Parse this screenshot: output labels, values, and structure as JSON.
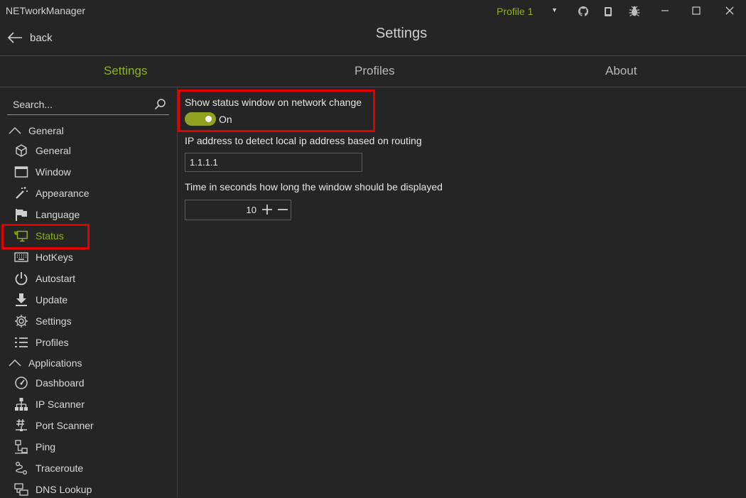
{
  "app": {
    "title": "NETworkManager",
    "profile": "Profile 1"
  },
  "header": {
    "back_label": "back",
    "title": "Settings"
  },
  "tabs": [
    {
      "label": "Settings",
      "active": true
    },
    {
      "label": "Profiles",
      "active": false
    },
    {
      "label": "About",
      "active": false
    }
  ],
  "sidebar": {
    "search_placeholder": "Search...",
    "group_general": "General",
    "group_applications": "Applications",
    "general_items": [
      {
        "label": "General",
        "icon": "cube-icon"
      },
      {
        "label": "Window",
        "icon": "window-icon"
      },
      {
        "label": "Appearance",
        "icon": "magic-wand-icon"
      },
      {
        "label": "Language",
        "icon": "flag-icon"
      },
      {
        "label": "Status",
        "icon": "monitor-network-icon",
        "active": true
      },
      {
        "label": "HotKeys",
        "icon": "keyboard-icon"
      },
      {
        "label": "Autostart",
        "icon": "power-icon"
      },
      {
        "label": "Update",
        "icon": "download-icon"
      },
      {
        "label": "Settings",
        "icon": "gear-icon"
      },
      {
        "label": "Profiles",
        "icon": "list-icon"
      }
    ],
    "application_items": [
      {
        "label": "Dashboard",
        "icon": "gauge-icon"
      },
      {
        "label": "IP Scanner",
        "icon": "sitemap-icon"
      },
      {
        "label": "Port Scanner",
        "icon": "hash-network-icon"
      },
      {
        "label": "Ping",
        "icon": "ping-icon"
      },
      {
        "label": "Traceroute",
        "icon": "route-icon"
      },
      {
        "label": "DNS Lookup",
        "icon": "dns-icon"
      }
    ]
  },
  "content": {
    "status_window_label": "Show status window on network change",
    "status_window_state": "On",
    "ip_label": "IP address to detect local ip address based on routing",
    "ip_value": "1.1.1.1",
    "time_label": "Time in seconds how long the window should be displayed",
    "time_value": "10"
  },
  "colors": {
    "accent": "#8fb021",
    "background": "#252525",
    "highlight": "#e00000"
  }
}
